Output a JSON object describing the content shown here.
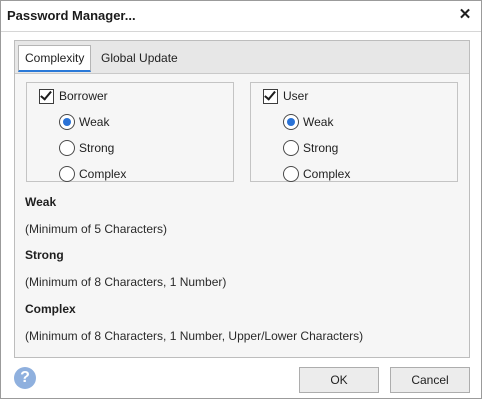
{
  "window": {
    "title": "Password Manager...",
    "close_symbol": "✕"
  },
  "tabs": [
    {
      "label": "Complexity",
      "active": true
    },
    {
      "label": "Global Update",
      "active": false
    }
  ],
  "groups": {
    "borrower": {
      "label": "Borrower",
      "checked": true,
      "options": [
        "Weak",
        "Strong",
        "Complex"
      ],
      "selected": "Weak"
    },
    "user": {
      "label": "User",
      "checked": true,
      "options": [
        "Weak",
        "Strong",
        "Complex"
      ],
      "selected": "Weak"
    }
  },
  "descriptions": [
    {
      "title": "Weak",
      "text": "(Minimum of 5 Characters)"
    },
    {
      "title": "Strong",
      "text": "(Minimum of 8 Characters, 1 Number)"
    },
    {
      "title": "Complex",
      "text": "(Minimum of 8 Characters, 1 Number, Upper/Lower Characters)"
    }
  ],
  "footer": {
    "help_symbol": "?",
    "ok_label": "OK",
    "cancel_label": "Cancel"
  },
  "colors": {
    "accent": "#2a72d6",
    "help_icon": "#8fb0de"
  }
}
